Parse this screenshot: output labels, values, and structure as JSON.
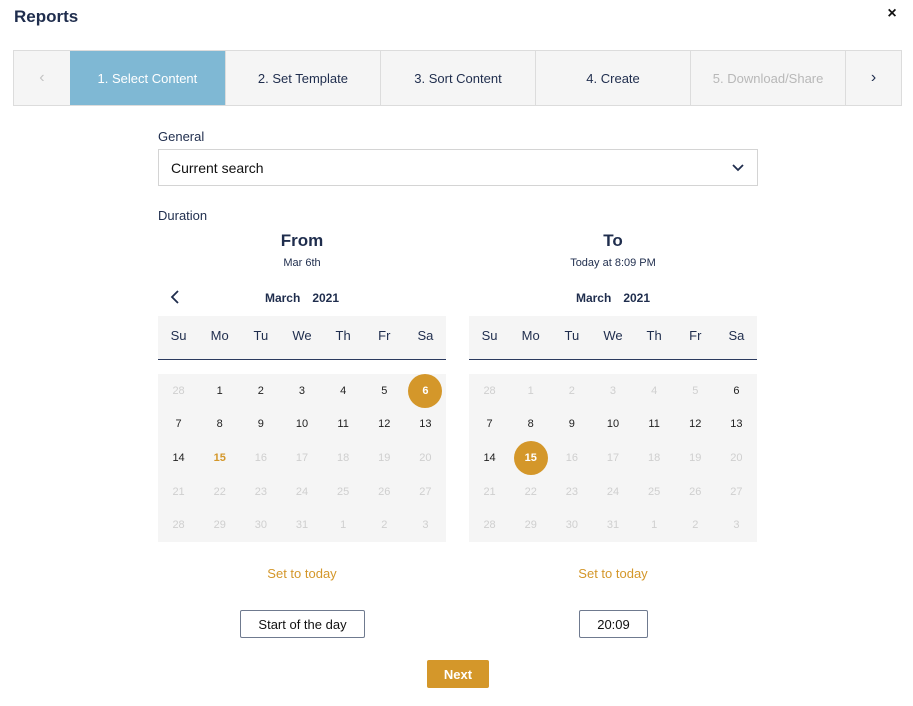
{
  "window": {
    "title": "Reports",
    "close_symbol": "×"
  },
  "stepper": {
    "steps": [
      {
        "label": "1. Select Content",
        "state": "active"
      },
      {
        "label": "2. Set Template",
        "state": "normal"
      },
      {
        "label": "3. Sort Content",
        "state": "normal"
      },
      {
        "label": "4. Create",
        "state": "normal"
      },
      {
        "label": "5. Download/Share",
        "state": "disabled"
      }
    ],
    "prev_symbol": "‹",
    "next_symbol": "›"
  },
  "general": {
    "label": "General",
    "selected": "Current search"
  },
  "duration": {
    "label": "Duration"
  },
  "from": {
    "heading": "From",
    "subtitle": "Mar 6th",
    "month": "March",
    "year": "2021",
    "weekdays": [
      "Su",
      "Mo",
      "Tu",
      "We",
      "Th",
      "Fr",
      "Sa"
    ],
    "days": [
      "28",
      "1",
      "2",
      "3",
      "4",
      "5",
      "6",
      "7",
      "8",
      "9",
      "10",
      "11",
      "12",
      "13",
      "14",
      "15",
      "16",
      "17",
      "18",
      "19",
      "20",
      "21",
      "22",
      "23",
      "24",
      "25",
      "26",
      "27",
      "28",
      "29",
      "30",
      "31",
      "1",
      "2",
      "3"
    ],
    "muted_indices": [
      0,
      16,
      17,
      18,
      19,
      20,
      21,
      22,
      23,
      24,
      25,
      26,
      27,
      28,
      29,
      30,
      31,
      32,
      33,
      34
    ],
    "selected_index": 6,
    "today_index": 15,
    "set_today_label": "Set to today",
    "time_button": "Start of the day"
  },
  "to": {
    "heading": "To",
    "subtitle": "Today at 8:09 PM",
    "month": "March",
    "year": "2021",
    "weekdays": [
      "Su",
      "Mo",
      "Tu",
      "We",
      "Th",
      "Fr",
      "Sa"
    ],
    "days": [
      "28",
      "1",
      "2",
      "3",
      "4",
      "5",
      "6",
      "7",
      "8",
      "9",
      "10",
      "11",
      "12",
      "13",
      "14",
      "15",
      "16",
      "17",
      "18",
      "19",
      "20",
      "21",
      "22",
      "23",
      "24",
      "25",
      "26",
      "27",
      "28",
      "29",
      "30",
      "31",
      "1",
      "2",
      "3"
    ],
    "muted_indices": [
      0,
      1,
      2,
      3,
      4,
      5,
      16,
      17,
      18,
      19,
      20,
      21,
      22,
      23,
      24,
      25,
      26,
      27,
      28,
      29,
      30,
      31,
      32,
      33,
      34
    ],
    "selected_index": 15,
    "today_index": -1,
    "set_today_label": "Set to today",
    "time_button": "20:09"
  },
  "actions": {
    "next_label": "Next"
  },
  "colors": {
    "accent": "#d4972a",
    "active_step": "#7fb8d4",
    "text": "#1f2d4d"
  }
}
